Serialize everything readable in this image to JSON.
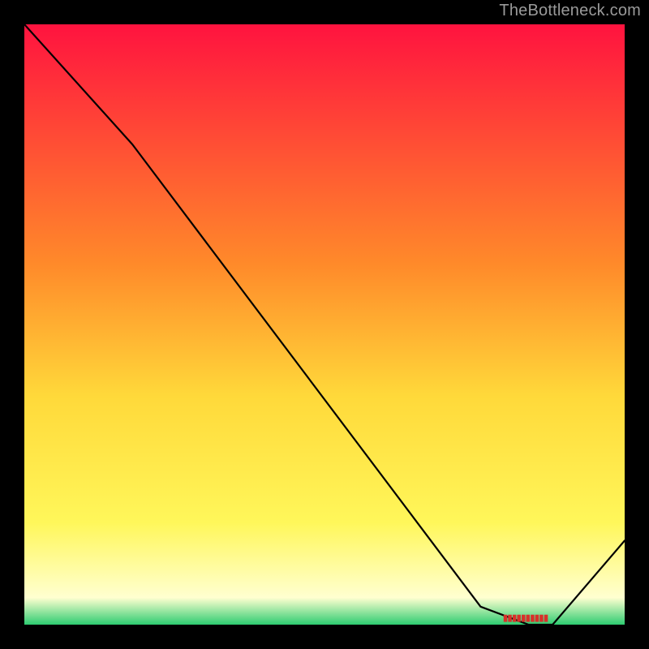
{
  "attribution": "TheBottleneck.com",
  "colors": {
    "gradient_top": "#ff133f",
    "gradient_upper_mid": "#ff8a2a",
    "gradient_mid": "#ffd93a",
    "gradient_lower_mid": "#fff75a",
    "gradient_pale": "#ffffd0",
    "gradient_green": "#2ecc71",
    "frame": "#000000",
    "line": "#000000",
    "marker_text": "#d8302a"
  },
  "chart_data": {
    "type": "line",
    "title": "",
    "xlabel": "",
    "ylabel": "",
    "x_range": [
      0,
      100
    ],
    "y_range": [
      0,
      100
    ],
    "grid": false,
    "legend": false,
    "series": [
      {
        "name": "bottleneck-curve",
        "x": [
          0,
          18,
          76,
          84,
          88,
          100
        ],
        "y": [
          100,
          80,
          3,
          0,
          0,
          14
        ]
      }
    ],
    "annotations": [
      {
        "name": "optimal-point",
        "x": 84,
        "y": 0,
        "shape": "flat-segment"
      }
    ]
  }
}
